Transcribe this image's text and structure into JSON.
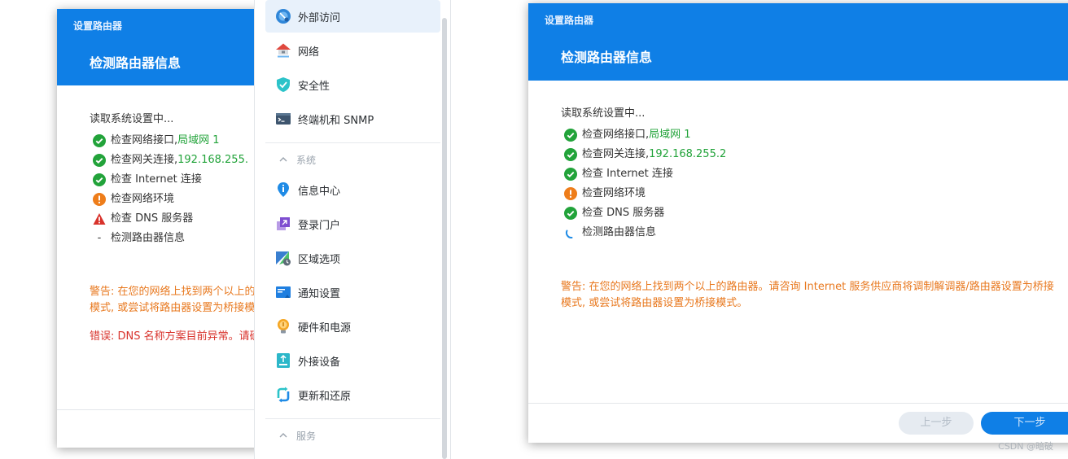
{
  "left_dialog": {
    "header_small": "设置路由器",
    "header_title": "检测路由器信息",
    "read_line": "读取系统设置中...",
    "checks": [
      {
        "label": "检查网络接口, ",
        "highlight": "局域网 1",
        "status": "ok"
      },
      {
        "label": "检查网关连接, ",
        "highlight": "192.168.255.",
        "status": "ok"
      },
      {
        "label": "检查 Internet 连接",
        "highlight": "",
        "status": "ok"
      },
      {
        "label": "检查网络环境",
        "highlight": "",
        "status": "warn"
      },
      {
        "label": "检查 DNS 服务器",
        "highlight": "",
        "status": "error"
      },
      {
        "label": "检测路由器信息",
        "highlight": "",
        "status": "pending"
      }
    ],
    "warning_line1": "警告: 在您的网络上找到两个以上的",
    "warning_line2": "模式, 或尝试将路由器设置为桥接模",
    "error_line": "错误: DNS 名称方案目前异常。请确"
  },
  "panel": {
    "items": [
      {
        "label": "外部访问",
        "icon": "external-access-icon",
        "active": true
      },
      {
        "label": "网络",
        "icon": "network-icon",
        "active": false
      },
      {
        "label": "安全性",
        "icon": "security-shield-icon",
        "active": false
      },
      {
        "label": "终端机和 SNMP",
        "icon": "terminal-icon",
        "active": false
      }
    ],
    "section_system": "系统",
    "system_items": [
      {
        "label": "信息中心",
        "icon": "info-center-icon"
      },
      {
        "label": "登录门户",
        "icon": "login-portal-icon"
      },
      {
        "label": "区域选项",
        "icon": "regional-options-icon"
      },
      {
        "label": "通知设置",
        "icon": "notification-icon"
      },
      {
        "label": "硬件和电源",
        "icon": "hardware-power-icon"
      },
      {
        "label": "外接设备",
        "icon": "external-devices-icon"
      },
      {
        "label": "更新和还原",
        "icon": "update-restore-icon"
      }
    ],
    "section_services": "服务"
  },
  "right_dialog": {
    "header_small": "设置路由器",
    "header_title": "检测路由器信息",
    "read_line": "读取系统设置中...",
    "checks": [
      {
        "label": "检查网络接口, ",
        "highlight": "局域网 1",
        "status": "ok"
      },
      {
        "label": "检查网关连接, ",
        "highlight": "192.168.255.2",
        "status": "ok"
      },
      {
        "label": "检查 Internet 连接",
        "highlight": "",
        "status": "ok"
      },
      {
        "label": "检查网络环境",
        "highlight": "",
        "status": "warn"
      },
      {
        "label": "检查 DNS 服务器",
        "highlight": "",
        "status": "ok"
      },
      {
        "label": "检测路由器信息",
        "highlight": "",
        "status": "loading"
      }
    ],
    "warning_line1": "警告: 在您的网络上找到两个以上的路由器。请咨询 Internet 服务供应商将调制解调器/路由器设置为桥接",
    "warning_line2": "模式, 或尝试将路由器设置为桥接模式。",
    "prev_button": "上一步",
    "next_button": "下一步"
  },
  "watermark": "CSDN @暗破",
  "colors": {
    "header_blue": "#0f7fe6",
    "ok_green": "#22a33a",
    "warn_orange": "#e8781e",
    "error_red": "#d8322b"
  }
}
